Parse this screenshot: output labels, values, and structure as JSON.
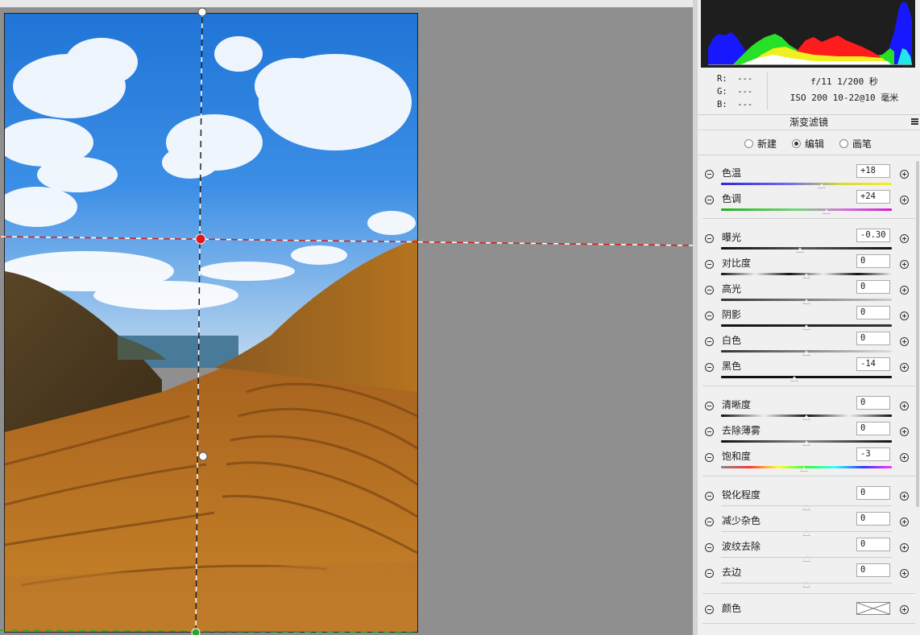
{
  "panel": {
    "rgb": {
      "r": "R:  ---",
      "g": "G:  ---",
      "b": "B:  ---"
    },
    "exif": {
      "line1": "f/11  1/200 秒",
      "line2": "ISO 200  10-22@10 毫米"
    },
    "section_title": "渐变滤镜",
    "modes": [
      {
        "label": "新建",
        "selected": false
      },
      {
        "label": "编辑",
        "selected": true
      },
      {
        "label": "画笔",
        "selected": false
      }
    ],
    "sliders": [
      {
        "label": "色温",
        "value": "+18",
        "pos": 0.59
      },
      {
        "label": "色调",
        "value": "+24",
        "pos": 0.62
      },
      {
        "label": "曝光",
        "value": "-0.30",
        "pos": 0.46
      },
      {
        "label": "对比度",
        "value": "0",
        "pos": 0.5
      },
      {
        "label": "高光",
        "value": "0",
        "pos": 0.5
      },
      {
        "label": "阴影",
        "value": "0",
        "pos": 0.5
      },
      {
        "label": "白色",
        "value": "0",
        "pos": 0.5
      },
      {
        "label": "黑色",
        "value": "-14",
        "pos": 0.43
      },
      {
        "label": "清晰度",
        "value": "0",
        "pos": 0.5
      },
      {
        "label": "去除薄雾",
        "value": "0",
        "pos": 0.5
      },
      {
        "label": "饱和度",
        "value": "-3",
        "pos": 0.485
      },
      {
        "label": "锐化程度",
        "value": "0",
        "pos": 0.5
      },
      {
        "label": "减少杂色",
        "value": "0",
        "pos": 0.5
      },
      {
        "label": "波纹去除",
        "value": "0",
        "pos": 0.5
      },
      {
        "label": "去边",
        "value": "0",
        "pos": 0.5
      }
    ],
    "color_label": "颜色"
  },
  "colors": {
    "accent_red": "#e01818",
    "accent_green": "#2aa52a"
  }
}
